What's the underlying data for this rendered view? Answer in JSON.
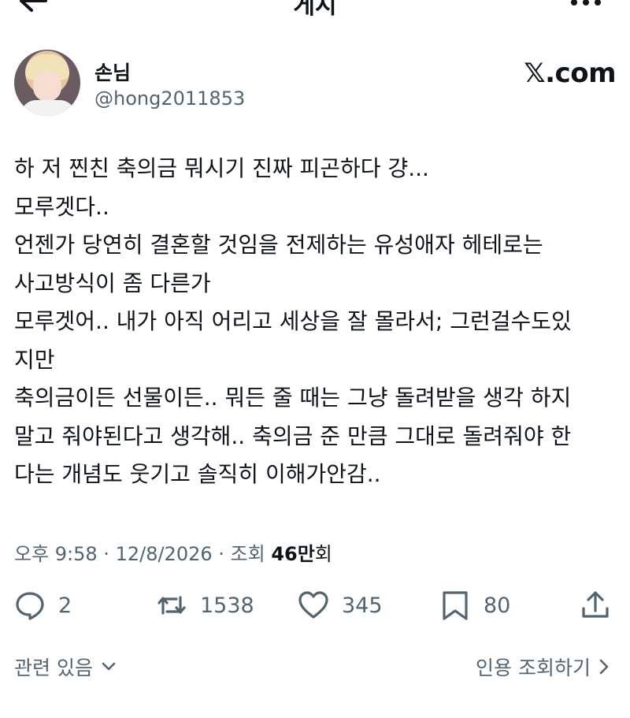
{
  "header": {
    "title": "게시",
    "back_icon": "arrow-left-icon",
    "more_icon": "more-horizontal-icon"
  },
  "author": {
    "display_name": "손님",
    "handle": "@hong2011853",
    "site": "𝕏.com"
  },
  "tweet": {
    "lines": [
      "하 저 찐친 축의금 뭐시기 진짜 피곤하다 걍...",
      "모루겟다..",
      "언젠가 당연히 결혼할 것임을 전제하는 유성애자 헤테로는",
      "사고방식이 좀 다른가",
      "모루겟어.. 내가 아직 어리고 세상을 잘 몰라서; 그런걸수도있",
      "지만",
      "축의금이든 선물이든.. 뭐든 줄 때는 그냥 돌려받을 생각 하지",
      "말고 줘야된다고 생각해.. 축의금 준 만큼 그대로 돌려줘야 한",
      "다는 개념도 웃기고 솔직히 이해가안감.."
    ]
  },
  "meta": {
    "time": "오후 9:58 · 12/8/2026 · 조회 ",
    "views_count": "46만",
    "views_unit": "회"
  },
  "actions": {
    "replies": "2",
    "reposts": "1538",
    "likes": "345",
    "bookmarks": "80"
  },
  "footer": {
    "related": "관련 있음",
    "quote_views": "인용 조회하기"
  },
  "colors": {
    "text": "#0f1419",
    "muted": "#536471",
    "background": "#ffffff"
  }
}
